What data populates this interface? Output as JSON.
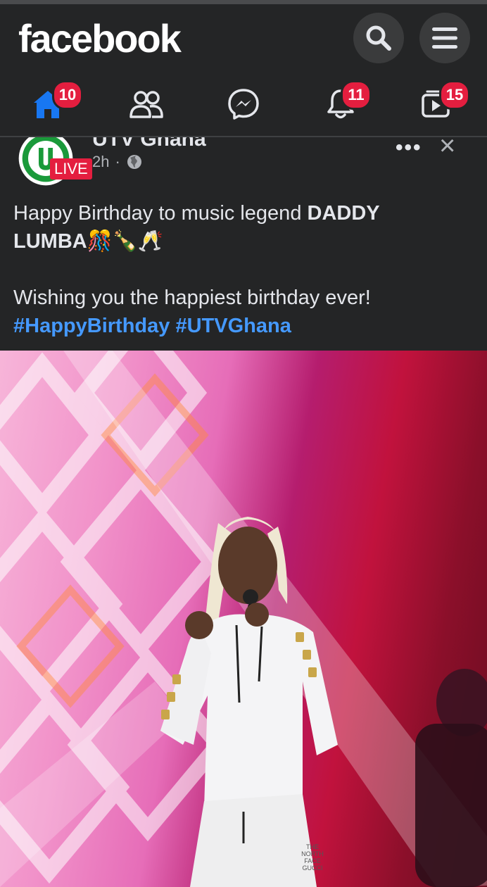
{
  "app": {
    "logo_text": "facebook"
  },
  "nav": {
    "home_badge": "10",
    "notifications_badge": "11",
    "watch_badge": "15"
  },
  "post": {
    "page_name": "UTV Ghana",
    "live_label": "LIVE",
    "time": "2h",
    "separator": "·",
    "text_line1_a": "Happy Birthday to music legend ",
    "text_line1_bold": "DADDY",
    "text_line2_bold": "LUMBA",
    "text_line2_emoji": "🎊🍾🥂",
    "text_line3": "Wishing you the happiest birthday ever!",
    "hashtag1": "#HappyBirthday",
    "hashtag2": "#UTVGhana",
    "jacket_text": "THE NORTH FACE GUCCI"
  },
  "colors": {
    "brand_blue": "#1877f2",
    "badge_red": "#e41e3f",
    "hashtag_blue": "#4599ff",
    "bg": "#242526"
  }
}
